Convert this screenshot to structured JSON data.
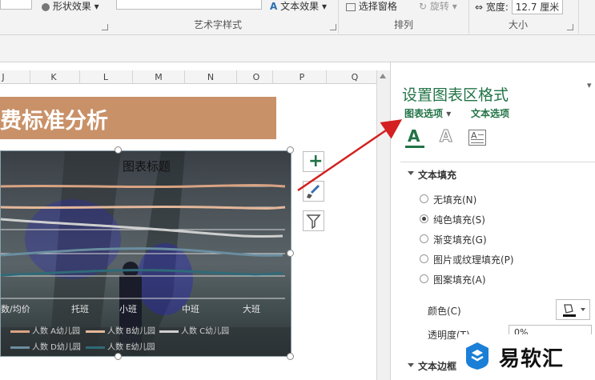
{
  "ribbon": {
    "shape_effects": "形状效果",
    "text_effects": "文本效果",
    "selection_pane": "选择窗格",
    "rotate": "旋转",
    "height_label": "宽度:",
    "width_value": "12.7 厘米",
    "group_wordart": "艺术字样式",
    "group_arrange": "排列",
    "group_size": "大小"
  },
  "columns": [
    "J",
    "K",
    "L",
    "M",
    "N",
    "O",
    "P",
    "Q"
  ],
  "sheet": {
    "banner_title": "费标准分析"
  },
  "chart": {
    "title": "图表标题",
    "x_labels": [
      "数/均价",
      "托班",
      "小班",
      "中班",
      "大班"
    ],
    "legend": [
      "人数 A幼儿园",
      "人数 B幼儿园",
      "人数 C幼儿园",
      "人数 D幼儿园",
      "人数 E幼儿园"
    ],
    "legend_colors": [
      "#d9a383",
      "#e3b79a",
      "#cfcfcf",
      "#6a8ea0",
      "#2f6a78"
    ]
  },
  "pane": {
    "title": "设置图表区格式",
    "tab_chart_options": "图表选项",
    "tab_text_options": "文本选项",
    "icons": [
      "text-fill-icon",
      "text-outline-icon",
      "text-box-icon"
    ],
    "section_fill": "文本填充",
    "options": [
      {
        "label": "无填充(N)",
        "checked": false
      },
      {
        "label": "纯色填充(S)",
        "checked": true
      },
      {
        "label": "渐变填充(G)",
        "checked": false
      },
      {
        "label": "图片或纹理填充(P)",
        "checked": false
      },
      {
        "label": "图案填充(A)",
        "checked": false
      }
    ],
    "color_label": "颜色(C)",
    "transparency_label": "透明度(T)",
    "transparency_value": "0%",
    "section_border": "文本边框"
  },
  "watermark": {
    "text": "易软汇"
  },
  "colors": {
    "accent": "#217346",
    "banner": "#c99168",
    "arrow": "#d42020"
  }
}
